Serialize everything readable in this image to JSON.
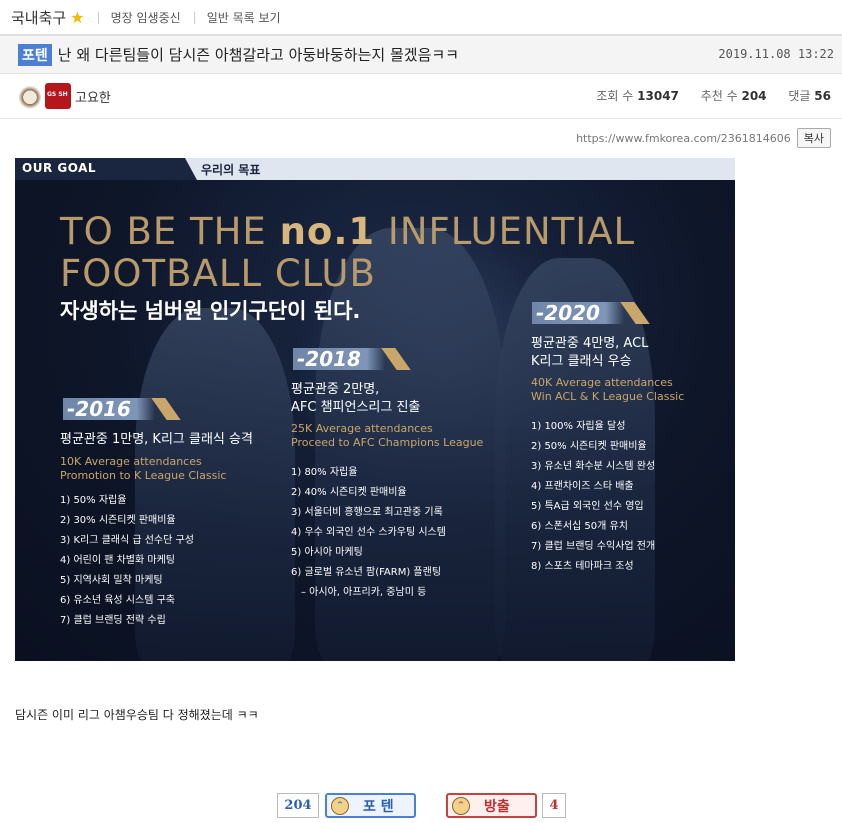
{
  "topbar": {
    "board_name": "국내축구",
    "links": [
      "명장 임생중신",
      "일반 목록 보기"
    ]
  },
  "post": {
    "category": "포텐",
    "title": "난 왜 다른팀들이 담시즌 아챔갈라고 아둥바둥하는지 몰겠음ㅋㅋ",
    "date": "2019.11.08 13:22",
    "author": "고요한",
    "stats": {
      "views_label": "조회 수",
      "views": "13047",
      "likes_label": "추천 수",
      "likes": "204",
      "comments_label": "댓글",
      "comments": "56"
    },
    "url": "https://www.fmkorea.com/2361814606",
    "copy_label": "복사",
    "body": "담시즌 이미 리그 아챔우승팀 다 정해졌는데 ㅋㅋ"
  },
  "banner": {
    "tab_left": "OUR GOAL",
    "tab_right": "우리의 목표",
    "headline_pre": "TO BE THE ",
    "headline_no1": "no.1",
    "headline_post": " INFLUENTIAL",
    "headline_line2": "FOOTBALL CLUB",
    "subhead": "자생하는 넘버원 인기구단이 된다.",
    "columns": [
      {
        "year": "-2016",
        "head": "평균관중 1만명, K리그 클래식 승격",
        "eng": [
          "10K Average attendances",
          "Promotion to K League Classic"
        ],
        "items": [
          "1) 50% 자립율",
          "2) 30% 시즌티켓 판매비율",
          "3) K리그 클래식 급 선수단 구성",
          "4) 어린이 팬 차별화 마케팅",
          "5) 지역사회 밀착 마케팅",
          "6) 유소년 육성 시스템 구축",
          "7) 클럽 브랜딩 전략 수립"
        ]
      },
      {
        "year": "-2018",
        "head": [
          "평균관중 2만명,",
          "AFC 챔피언스리그 진출"
        ],
        "eng": [
          "25K Average attendances",
          "Proceed to AFC Champions League"
        ],
        "items": [
          "1) 80% 자립율",
          "2) 40% 시즌티켓 판매비율",
          "3) 서울더비 흥행으로 최고관중 기록",
          "4) 우수 외국인 선수 스카우팅 시스템",
          "5) 아시아 마케팅",
          "6) 글로벌 유소년 팜(FARM) 플랜팅",
          "– 아시아, 아프리카, 중남미 등"
        ]
      },
      {
        "year": "-2020",
        "head": [
          "평균관중 4만명, ACL",
          "K리그 클래식 우승"
        ],
        "eng": [
          "40K Average attendances",
          "Win ACL & K League Classic"
        ],
        "items": [
          "1) 100% 자립율 달성",
          "2) 50% 시즌티켓 판매비율",
          "3) 유소년 화수분 시스템 완성",
          "4) 프랜차이즈 스타 배출",
          "5) 특A급 외국인 선수 영입",
          "6) 스폰서십 50개 유치",
          "7) 클럽 브랜딩 수익사업 전개",
          "8) 스포츠 테마파크 조성"
        ]
      }
    ]
  },
  "votes": {
    "up_count": "204",
    "up_label": "포 텐",
    "down_label": "방출",
    "down_count": "4"
  },
  "colors": {
    "accent": "#4a7fd4",
    "gold": "#c9a66a",
    "banner_bg": "#0e1629",
    "down": "#c84040"
  }
}
